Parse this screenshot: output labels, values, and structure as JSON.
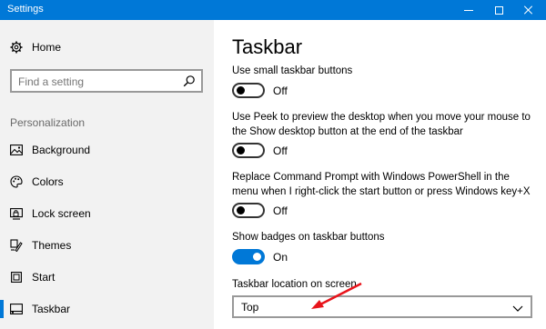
{
  "window": {
    "title": "Settings"
  },
  "sidebar": {
    "home_label": "Home",
    "search_placeholder": "Find a setting",
    "section_title": "Personalization",
    "items": [
      {
        "label": "Background",
        "icon": "picture-icon"
      },
      {
        "label": "Colors",
        "icon": "palette-icon"
      },
      {
        "label": "Lock screen",
        "icon": "lock-screen-icon"
      },
      {
        "label": "Themes",
        "icon": "brush-icon"
      },
      {
        "label": "Start",
        "icon": "start-icon"
      },
      {
        "label": "Taskbar",
        "icon": "taskbar-icon",
        "selected": true
      }
    ]
  },
  "main": {
    "title": "Taskbar",
    "settings": [
      {
        "label": "Use small taskbar buttons",
        "state": "Off"
      },
      {
        "label": "Use Peek to preview the desktop when you move your mouse to the Show desktop button at the end of the taskbar",
        "state": "Off"
      },
      {
        "label": "Replace Command Prompt with Windows PowerShell in the menu when I right-click the start button or press Windows key+X",
        "state": "Off"
      },
      {
        "label": "Show badges on taskbar buttons",
        "state": "On"
      }
    ],
    "location": {
      "label": "Taskbar location on screen",
      "value": "Top"
    }
  },
  "colors": {
    "accent": "#0078d7",
    "annotation_arrow": "#e8141b"
  }
}
